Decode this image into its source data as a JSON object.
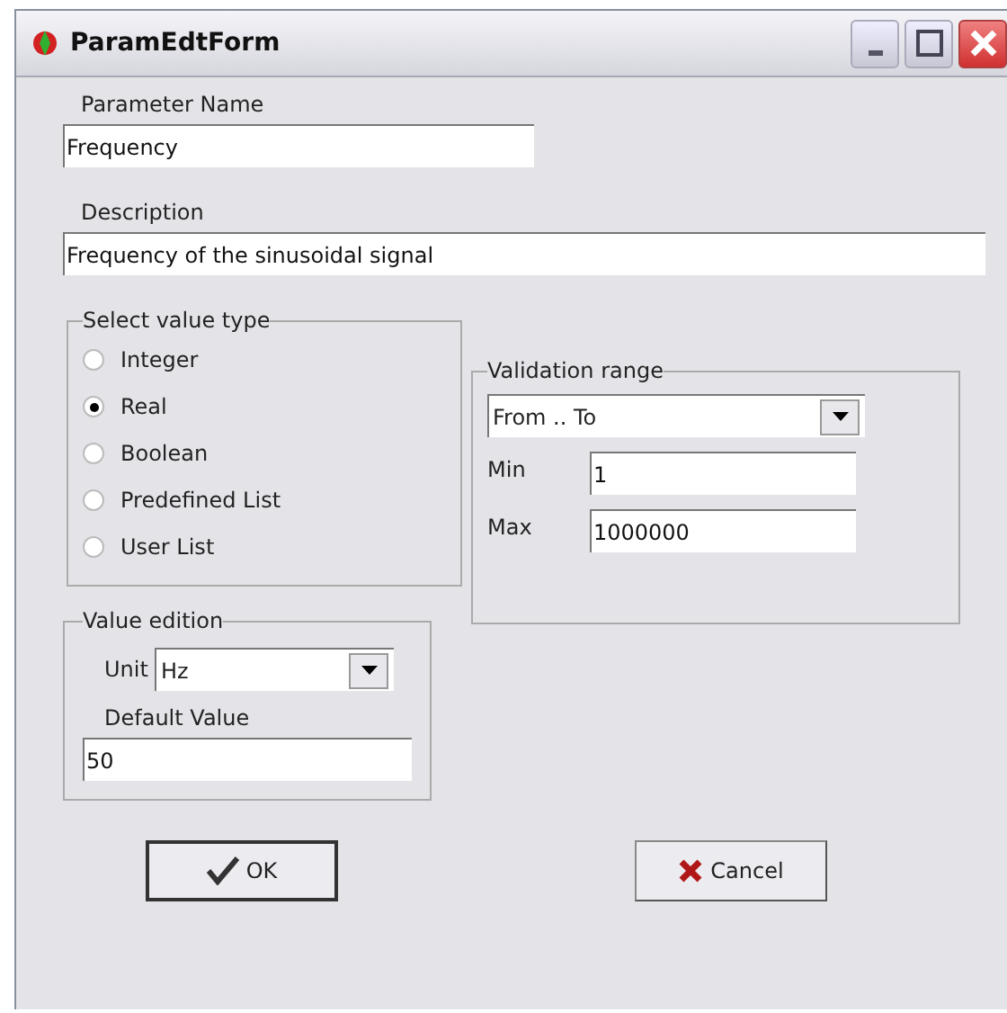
{
  "window": {
    "title": "ParamEdtForm"
  },
  "parameter_name": {
    "label": "Parameter Name",
    "value": "Frequency"
  },
  "description": {
    "label": "Description",
    "value": "Frequency of the sinusoidal signal"
  },
  "value_type": {
    "legend": "Select value type",
    "options": [
      {
        "label": "Integer",
        "selected": false
      },
      {
        "label": "Real",
        "selected": true
      },
      {
        "label": "Boolean",
        "selected": false
      },
      {
        "label": "Predefined List",
        "selected": false
      },
      {
        "label": "User List",
        "selected": false
      }
    ]
  },
  "validation_range": {
    "legend": "Validation range",
    "mode": "From .. To",
    "min": {
      "label": "Min",
      "value": "1"
    },
    "max": {
      "label": "Max",
      "value": "1000000"
    }
  },
  "value_edition": {
    "legend": "Value edition",
    "unit": {
      "label": "Unit",
      "value": "Hz"
    },
    "default": {
      "label": "Default Value",
      "value": "50"
    }
  },
  "buttons": [
    {
      "label": "OK",
      "kind": "ok"
    },
    {
      "label": "Cancel",
      "kind": "cancel"
    }
  ]
}
